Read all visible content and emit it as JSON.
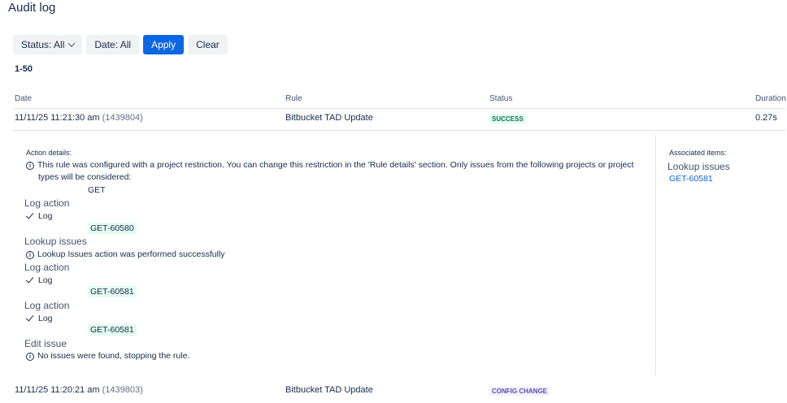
{
  "page": {
    "title": "Audit log"
  },
  "filters": {
    "status_label": "Status: All",
    "date_label": "Date: All",
    "apply_label": "Apply",
    "clear_label": "Clear"
  },
  "range": "1-50",
  "table": {
    "headers": {
      "date": "Date",
      "rule": "Rule",
      "status": "Status",
      "duration": "Duration"
    },
    "rows": [
      {
        "date": "11/11/25 11:21:30 am",
        "id": "(1439804)",
        "rule": "Bitbucket TAD Update",
        "status": "SUCCESS",
        "duration": "0.27s"
      },
      {
        "date": "11/11/25 11:20:21 am",
        "id": "(1439803)",
        "rule": "Bitbucket TAD Update",
        "status": "CONFIG CHANGE",
        "duration": ""
      }
    ]
  },
  "details": {
    "action_details_label": "Action details:",
    "restriction_text_1": "This rule was configured with a project restriction. You can change this restriction in the 'Rule details' section. Only issues from the following projects or project",
    "restriction_text_2": "types will be considered:",
    "project": "GET",
    "steps": [
      {
        "heading": "Log action",
        "status": "Log",
        "key": "GET-60580"
      },
      {
        "heading": "Lookup issues",
        "message": "Lookup Issues action was performed successfully"
      },
      {
        "heading": "Log action",
        "status": "Log",
        "key": "GET-60581"
      },
      {
        "heading": "Log action",
        "status": "Log",
        "key": "GET-60581"
      },
      {
        "heading": "Edit issue",
        "message": "No issues were found, stopping the rule."
      }
    ],
    "associated": {
      "label": "Associated items:",
      "heading": "Lookup issues",
      "link": "GET-60581"
    }
  },
  "colors": {
    "primary": "#0c66e4",
    "success": "#216e4e",
    "config": "#5e4db2"
  }
}
